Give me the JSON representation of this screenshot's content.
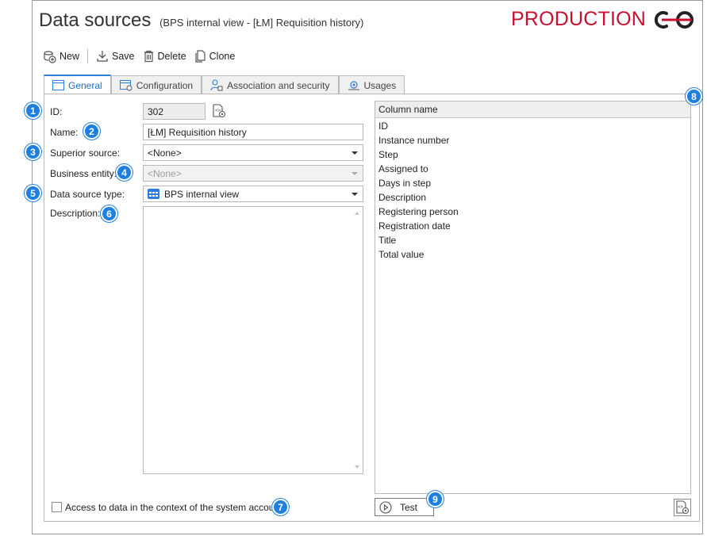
{
  "header": {
    "title": "Data sources",
    "subtitle": "(BPS internal view - [ŁM] Requisition history)",
    "environment": "PRODUCTION",
    "environment_color": "#c8102e"
  },
  "toolbar": {
    "new_label": "New",
    "save_label": "Save",
    "delete_label": "Delete",
    "clone_label": "Clone"
  },
  "tabs": [
    {
      "label": "General",
      "active": true
    },
    {
      "label": "Configuration",
      "active": false
    },
    {
      "label": "Association and security",
      "active": false
    },
    {
      "label": "Usages",
      "active": false
    }
  ],
  "form": {
    "id_label": "ID:",
    "id_value": "302",
    "name_label": "Name:",
    "name_value": "[ŁM] Requisition history",
    "superior_label": "Superior source:",
    "superior_value": "<None>",
    "business_label": "Business entity:",
    "business_value": "<None>",
    "type_label": "Data source type:",
    "type_value": "BPS internal view",
    "description_label": "Description:",
    "description_value": "",
    "system_account_label": "Access to data in the context of the system account",
    "system_account_checked": false
  },
  "columns": {
    "header": "Column name",
    "items": [
      "ID",
      "Instance number",
      "Step",
      "Assigned to",
      "Days in step",
      "Description",
      "Registering person",
      "Registration date",
      "Title",
      "Total value"
    ]
  },
  "test_label": "Test",
  "badges": [
    "1",
    "2",
    "3",
    "4",
    "5",
    "6",
    "7",
    "8",
    "9"
  ],
  "accent_color": "#1e7fdf"
}
